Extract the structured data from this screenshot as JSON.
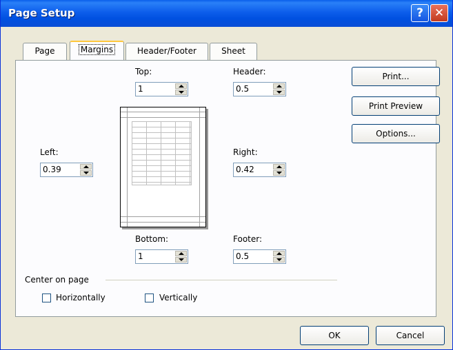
{
  "window": {
    "title": "Page Setup",
    "help_glyph": "?",
    "close_glyph": "✕"
  },
  "tabs": [
    {
      "label": "Page",
      "active": false
    },
    {
      "label": "Margins",
      "active": true
    },
    {
      "label": "Header/Footer",
      "active": false
    },
    {
      "label": "Sheet",
      "active": false
    }
  ],
  "margins": {
    "top": {
      "label": "Top:",
      "value": "1"
    },
    "header": {
      "label": "Header:",
      "value": "0.5"
    },
    "left": {
      "label": "Left:",
      "value": "0.39"
    },
    "right": {
      "label": "Right:",
      "value": "0.42"
    },
    "bottom": {
      "label": "Bottom:",
      "value": "1"
    },
    "footer": {
      "label": "Footer:",
      "value": "0.5"
    }
  },
  "side_buttons": {
    "print": "Print...",
    "print_preview": "Print Preview",
    "options": "Options..."
  },
  "center_on_page": {
    "label": "Center on page",
    "horizontally": {
      "label": "Horizontally",
      "checked": false
    },
    "vertically": {
      "label": "Vertically",
      "checked": false
    }
  },
  "footer_buttons": {
    "ok": "OK",
    "cancel": "Cancel"
  },
  "colors": {
    "titlebar": "#0A5FEA",
    "dialog_bg": "#ECE9D8",
    "tab_highlight": "#FFC73C",
    "close_button": "#C23B1F"
  }
}
